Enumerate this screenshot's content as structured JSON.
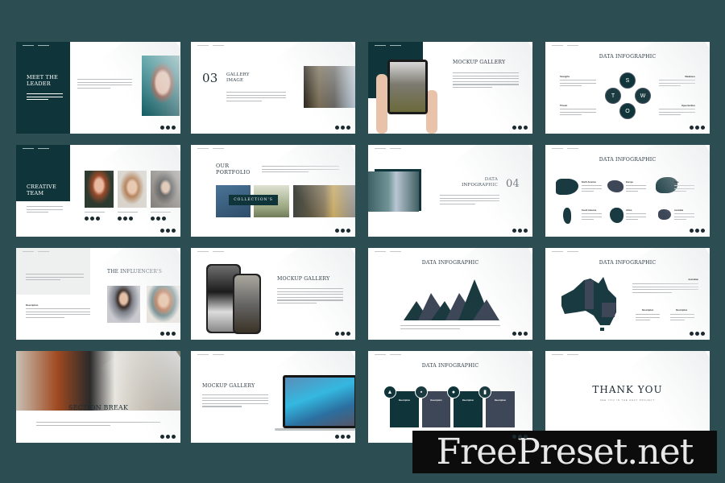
{
  "colors": {
    "background": "#2c4d51",
    "dark_teal": "#0f3439",
    "slate": "#3e4758",
    "white": "#ffffff"
  },
  "slides": [
    {
      "title": "MEET THE LEADER"
    },
    {
      "number": "03",
      "title": "GALLERY IMAGE"
    },
    {
      "title": "MOCKUP GALLERY"
    },
    {
      "title_light": "DATA",
      "title_bold": "INFOGRAPHIC",
      "swot": [
        "S",
        "T",
        "W",
        "O"
      ],
      "labels": [
        "Strengths",
        "Weakness",
        "Threats",
        "Opportunities"
      ]
    },
    {
      "title": "CREATIVE TEAM"
    },
    {
      "title": "OUR PORTFOLIO",
      "banner": "COLLECTION'S"
    },
    {
      "title": "DATA INFOGRAPHIC",
      "number": "04"
    },
    {
      "title_light": "DATA",
      "title_bold": "INFOGRAPHIC",
      "regions": [
        "North America",
        "Europe",
        "Asia",
        "South America",
        "Africa",
        "Australia"
      ]
    },
    {
      "title": "THE INFLUENCER'S",
      "label": "Description"
    },
    {
      "title": "MOCKUP GALLERY"
    },
    {
      "title_light": "DATA",
      "title_bold": "INFOGRAPHIC"
    },
    {
      "title_light": "DATA",
      "title_bold": "INFOGRAPHIC",
      "labels": [
        "Australian",
        "Description",
        "Description"
      ]
    },
    {
      "title": "SECTION BREAK"
    },
    {
      "title": "MOCKUP GALLERY"
    },
    {
      "title_light": "DATA",
      "title_bold": "INFOGRAPHIC",
      "boxes": [
        "Description",
        "Description",
        "Description",
        "Description"
      ]
    },
    {
      "title": "THANK YOU",
      "subtitle": "SEE YOU IN THE NEXT PROJECT"
    }
  ],
  "watermark": "FreePreset.net"
}
